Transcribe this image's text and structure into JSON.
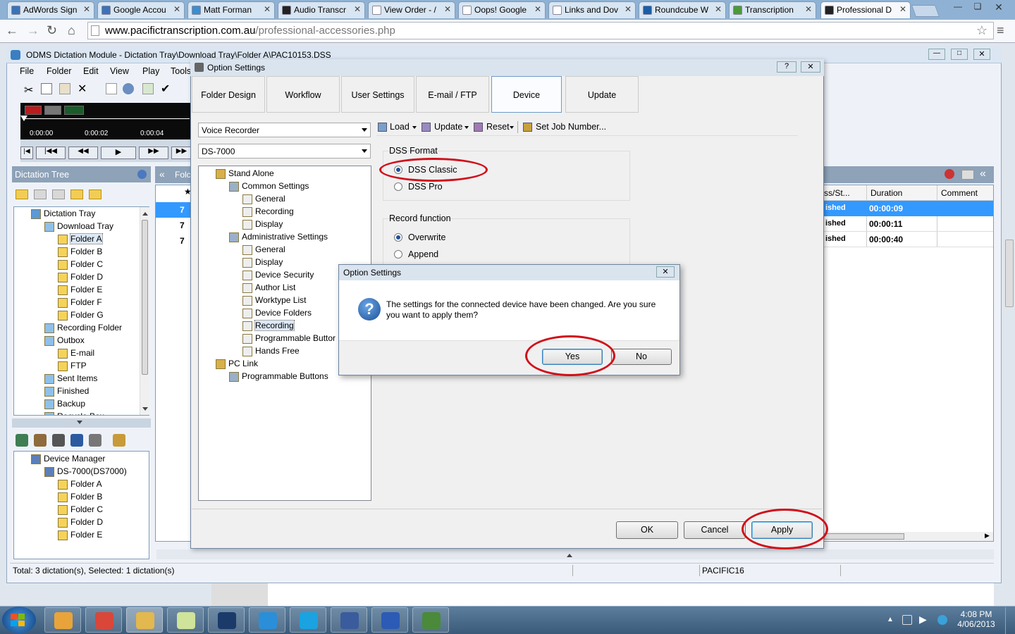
{
  "browser": {
    "tabs": [
      {
        "label": "AdWords Sign",
        "color": "#3b73b9"
      },
      {
        "label": "Google Accou",
        "color": "#3b73b9"
      },
      {
        "label": "Matt Forman",
        "color": "#3b8ed0"
      },
      {
        "label": "Audio Transcr",
        "color": "#222222"
      },
      {
        "label": "View Order - /",
        "color": "#ffffff"
      },
      {
        "label": "Oops! Google",
        "color": "#ffffff"
      },
      {
        "label": "Links and Dov",
        "color": "#ffffff"
      },
      {
        "label": "Roundcube W",
        "color": "#1a5ea8"
      },
      {
        "label": "Transcription",
        "color": "#4a9a3a"
      },
      {
        "label": "Professional D",
        "color": "#222222"
      }
    ],
    "url_host": "www.pacifictranscription.com.au",
    "url_path": "/professional-accessories.php"
  },
  "odms": {
    "title": "ODMS Dictation Module - Dictation Tray\\Download Tray\\Folder A\\PAC10153.DSS",
    "menu": [
      "File",
      "Folder",
      "Edit",
      "View",
      "Play",
      "Tools"
    ],
    "times": [
      "0:00:00",
      "0:00:02",
      "0:00:04"
    ],
    "dictation_tree_title": "Dictation Tree",
    "tray_tree": [
      {
        "label": "Dictation Tray",
        "level": 0
      },
      {
        "label": "Download Tray",
        "level": 1
      },
      {
        "label": "Folder A",
        "level": 2
      },
      {
        "label": "Folder B",
        "level": 2
      },
      {
        "label": "Folder C",
        "level": 2
      },
      {
        "label": "Folder D",
        "level": 2
      },
      {
        "label": "Folder E",
        "level": 2
      },
      {
        "label": "Folder F",
        "level": 2
      },
      {
        "label": "Folder G",
        "level": 2
      },
      {
        "label": "Recording Folder",
        "level": 1
      },
      {
        "label": "Outbox",
        "level": 1
      },
      {
        "label": "E-mail",
        "level": 2
      },
      {
        "label": "FTP",
        "level": 2
      },
      {
        "label": "Sent Items",
        "level": 1
      },
      {
        "label": "Finished",
        "level": 1
      },
      {
        "label": "Backup",
        "level": 1
      },
      {
        "label": "Recycle Box",
        "level": 1
      }
    ],
    "device_tree": [
      {
        "label": "Device Manager",
        "level": 0
      },
      {
        "label": "DS-7000(DS7000)",
        "level": 1
      },
      {
        "label": "Folder A",
        "level": 2
      },
      {
        "label": "Folder B",
        "level": 2
      },
      {
        "label": "Folder C",
        "level": 2
      },
      {
        "label": "Folder D",
        "level": 2
      },
      {
        "label": "Folder E",
        "level": 2
      }
    ],
    "list_headers": {
      "status": "ss/St...",
      "duration": "Duration",
      "comment": "Comment"
    },
    "list_rows": [
      {
        "num": "7",
        "status": "ished",
        "duration": "00:00:09"
      },
      {
        "num": "7",
        "status": "ished",
        "duration": "00:00:11"
      },
      {
        "num": "7",
        "status": "ished",
        "duration": "00:00:40"
      }
    ],
    "middle_tab_label": "Folc",
    "status_text": "Total: 3 dictation(s), Selected: 1 dictation(s)",
    "status_user": "PACIFIC16"
  },
  "options": {
    "title": "Option Settings",
    "tabs": [
      "Folder Design",
      "Workflow",
      "User Settings",
      "E-mail / FTP",
      "Device",
      "Update"
    ],
    "device_type": "Voice Recorder",
    "model": "DS-7000",
    "toolbar": {
      "load": "Load",
      "update": "Update",
      "reset": "Reset",
      "set_job": "Set Job Number..."
    },
    "tree": [
      {
        "label": "Stand Alone",
        "level": 0
      },
      {
        "label": "Common Settings",
        "level": 1
      },
      {
        "label": "General",
        "level": 2
      },
      {
        "label": "Recording",
        "level": 2
      },
      {
        "label": "Display",
        "level": 2
      },
      {
        "label": "Administrative Settings",
        "level": 1
      },
      {
        "label": "General",
        "level": 2
      },
      {
        "label": "Display",
        "level": 2
      },
      {
        "label": "Device Security",
        "level": 2
      },
      {
        "label": "Author List",
        "level": 2
      },
      {
        "label": "Worktype List",
        "level": 2
      },
      {
        "label": "Device Folders",
        "level": 2
      },
      {
        "label": "Recording",
        "level": 2
      },
      {
        "label": "Programmable Buttor",
        "level": 2
      },
      {
        "label": "Hands Free",
        "level": 2
      },
      {
        "label": "PC Link",
        "level": 0
      },
      {
        "label": "Programmable Buttons",
        "level": 1
      }
    ],
    "dss_format": {
      "label": "DSS Format",
      "classic": "DSS Classic",
      "pro": "DSS Pro"
    },
    "record_function": {
      "label": "Record function",
      "overwrite": "Overwrite",
      "append": "Append"
    },
    "buttons": {
      "ok": "OK",
      "cancel": "Cancel",
      "apply": "Apply"
    }
  },
  "confirm": {
    "title": "Option Settings",
    "line1": "The settings for the connected device have been changed. Are you sure",
    "line2": "you want to apply them?",
    "yes": "Yes",
    "no": "No"
  },
  "taskbar": {
    "time": "4:08 PM",
    "date": "4/06/2013",
    "apps": [
      "outlook-app",
      "chrome-app",
      "explorer-app",
      "notes-app",
      "pen-app",
      "ie-app",
      "skype-app",
      "dictation-app",
      "word-app",
      "transcription-app"
    ]
  }
}
